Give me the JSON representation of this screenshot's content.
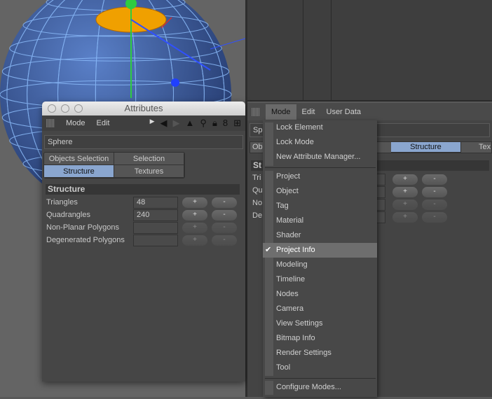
{
  "attributes_window": {
    "title": "Attributes",
    "menu": [
      "Mode",
      "Edit"
    ],
    "object_name": "Sphere",
    "tabs": [
      {
        "label": "Objects Selection",
        "active": false
      },
      {
        "label": "Selection",
        "active": false
      },
      {
        "label": "Structure",
        "active": true
      },
      {
        "label": "Textures",
        "active": false
      }
    ],
    "section": "Structure",
    "rows": [
      {
        "label": "Triangles",
        "value": "48",
        "enabled": true
      },
      {
        "label": "Quadrangles",
        "value": "240",
        "enabled": true
      },
      {
        "label": "Non-Planar Polygons",
        "value": "",
        "enabled": false
      },
      {
        "label": "Degenerated Polygons",
        "value": "",
        "enabled": false
      }
    ],
    "plus": "+",
    "minus": "-",
    "tool_icons": [
      "play-arrow-icon",
      "back-arrow-icon",
      "forward-arrow-icon",
      "up-arrow-icon",
      "search-icon",
      "lock-icon",
      "link-icon",
      "new-panel-icon"
    ]
  },
  "attribute_manager": {
    "menu": [
      "Mode",
      "Edit",
      "User Data"
    ],
    "active_menu": "Mode",
    "partial_name": "Sp",
    "partial_tabs": [
      "Ob",
      "Structure",
      "Tex"
    ],
    "partial_section": "St",
    "partial_rows": [
      "Tri",
      "Qu",
      "No",
      "De"
    ]
  },
  "mode_menu": {
    "group1": [
      "Lock Element",
      "Lock Mode",
      "New Attribute Manager..."
    ],
    "group2": [
      "Project",
      "Object",
      "Tag",
      "Material",
      "Shader",
      "Project Info",
      "Modeling",
      "Timeline",
      "Nodes",
      "Camera",
      "View Settings",
      "Bitmap Info",
      "Render Settings",
      "Tool"
    ],
    "checked": "Project Info",
    "checkmark": "✔",
    "group3": [
      "Configure Modes..."
    ]
  },
  "colors": {
    "accent": "#8aa6cf",
    "sphere": "#3b5ea8",
    "wire": "#8fc0ff",
    "selection": "#f0a000"
  }
}
